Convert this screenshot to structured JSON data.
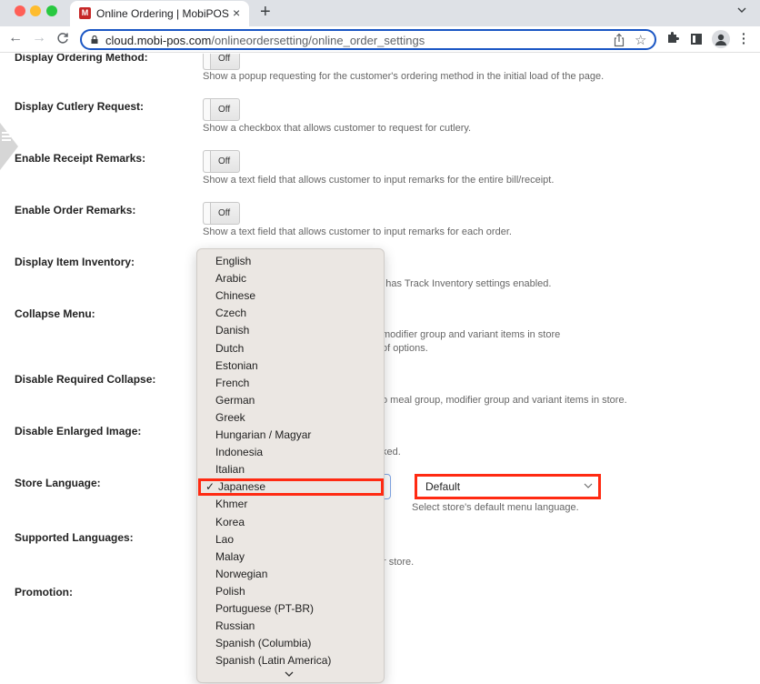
{
  "browser": {
    "tab_title": "Online Ordering | MobiPOS",
    "favicon_letter": "M",
    "url_host": "cloud.mobi-pos.com",
    "url_path": "/onlineordersetting/online_order_settings"
  },
  "settings": [
    {
      "label": "Display Ordering Method:",
      "toggle": "Off",
      "help": "Show a popup requesting for the customer's ordering method in the initial load of the page."
    },
    {
      "label": "Display Cutlery Request:",
      "toggle": "Off",
      "help": "Show a checkbox that allows customer to request for cutlery."
    },
    {
      "label": "Enable Receipt Remarks:",
      "toggle": "Off",
      "help": "Show a text field that allows customer to input remarks for the entire bill/receipt."
    },
    {
      "label": "Enable Order Remarks:",
      "toggle": "Off",
      "help": "Show a text field that allows customer to input remarks for each order."
    },
    {
      "label": "Display Item Inventory:",
      "help": "at has Track Inventory settings enabled."
    },
    {
      "label": "Collapse Menu:",
      "help_lines": [
        "modifier group and variant items in store",
        "of options."
      ]
    },
    {
      "label": "Disable Required Collapse:",
      "help": "o meal group, modifier group and variant items in store."
    },
    {
      "label": "Disable Enlarged Image:",
      "help": "ked."
    },
    {
      "label": "Store Language:",
      "default_select_value": "Default",
      "help": "Select store's default menu language."
    },
    {
      "label": "Supported Languages:",
      "help": "r store."
    },
    {
      "label": "Promotion:"
    }
  ],
  "language_dropdown": {
    "selected": "Japanese",
    "check_glyph": "✓",
    "options": [
      "English",
      "Arabic",
      "Chinese",
      "Czech",
      "Danish",
      "Dutch",
      "Estonian",
      "French",
      "German",
      "Greek",
      "Hungarian / Magyar",
      "Indonesia",
      "Italian",
      "Japanese",
      "Khmer",
      "Korea",
      "Lao",
      "Malay",
      "Norwegian",
      "Polish",
      "Portuguese (PT-BR)",
      "Russian",
      "Spanish (Columbia)",
      "Spanish (Latin America)"
    ]
  },
  "icons": {
    "tab_close": "×",
    "new_tab": "+",
    "back": "←",
    "forward": "→",
    "reload": "C",
    "star": "☆",
    "chevron_down": "⌄",
    "kebab": "⋮"
  },
  "colors": {
    "highlight_red": "#ff2a12",
    "omnibox_blue": "#1a56c4",
    "dropdown_bg": "#ebe7e3"
  }
}
